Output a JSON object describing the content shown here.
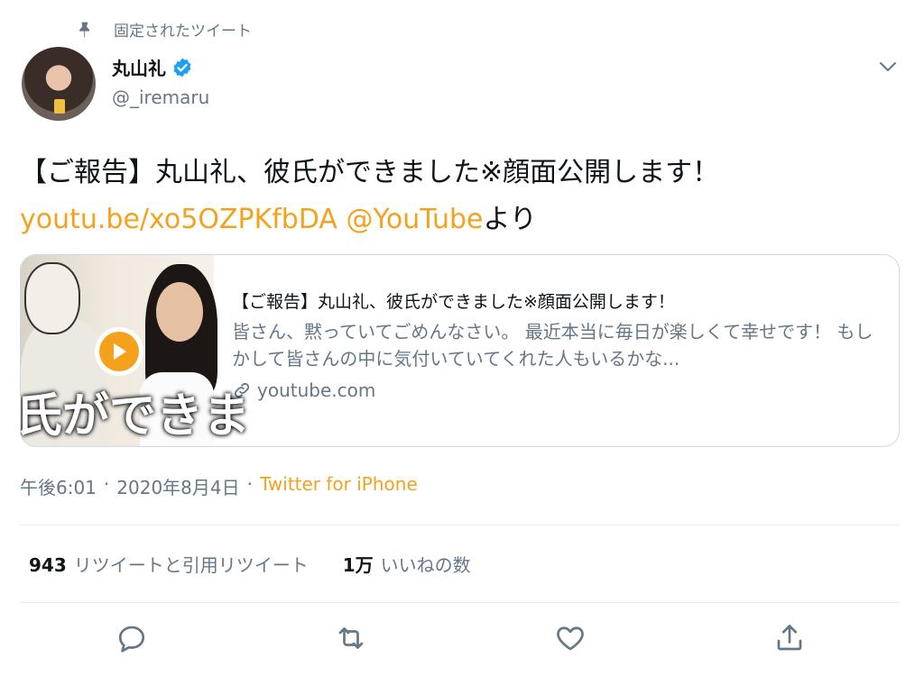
{
  "pinned": {
    "label": "固定されたツイート",
    "icon": "pin-icon"
  },
  "author": {
    "display_name": "丸山礼",
    "handle": "@_iremaru",
    "verified": true
  },
  "tweet": {
    "text": "【ご報告】丸山礼、彼氏ができました※顔面公開します！",
    "link": "youtu.be/xo5OZPKfbDA",
    "mention": "@YouTube",
    "suffix": "より"
  },
  "card": {
    "thumbnail_text": "氏ができま",
    "title": "【ご報告】丸山礼、彼氏ができました※顔面公開します！",
    "description": "皆さん、黙っていてごめんなさい。 最近本当に毎日が楽しくて幸せです！ もしかして皆さんの中に気付いていてくれた人もいるかな...",
    "domain": "youtube.com"
  },
  "meta": {
    "time": "午後6:01",
    "sep1": "·",
    "date": "2020年8月4日",
    "sep2": "·",
    "source": "Twitter for iPhone"
  },
  "stats": {
    "retweets_count": "943",
    "retweets_label": "リツイートと引用リツイート",
    "likes_count": "1万",
    "likes_label": "いいねの数"
  },
  "colors": {
    "link": "#f4a21e",
    "verified": "#1da1f2",
    "secondary_text": "#657786"
  }
}
